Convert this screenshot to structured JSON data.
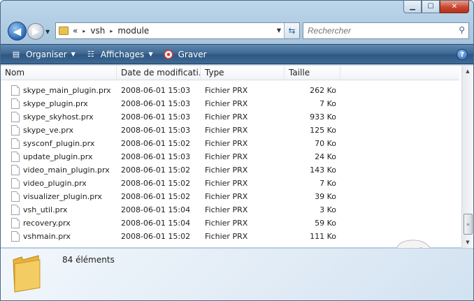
{
  "titlebar": {
    "buttons": {
      "minimize": "▁",
      "maximize": "☐",
      "close": "✕"
    }
  },
  "navigation": {
    "back_icon": "back-arrow-icon",
    "forward_icon": "forward-arrow-icon",
    "history_icon": "chevron-down-icon"
  },
  "address": {
    "overflow": "«",
    "segments": [
      "vsh",
      "module"
    ],
    "separator": "▸",
    "refresh_icon": "refresh-icon"
  },
  "search": {
    "placeholder": "Rechercher",
    "value": ""
  },
  "toolbar": {
    "organize_label": "Organiser",
    "views_label": "Affichages",
    "burn_label": "Graver",
    "help_label": "?"
  },
  "columns": {
    "name": "Nom",
    "date": "Date de modificati...",
    "type": "Type",
    "size": "Taille"
  },
  "files": [
    {
      "name": "skype_main_plugin.prx",
      "date": "2008-06-01 15:03",
      "type": "Fichier PRX",
      "size": "262 Ko"
    },
    {
      "name": "skype_plugin.prx",
      "date": "2008-06-01 15:03",
      "type": "Fichier PRX",
      "size": "7 Ko"
    },
    {
      "name": "skype_skyhost.prx",
      "date": "2008-06-01 15:03",
      "type": "Fichier PRX",
      "size": "933 Ko"
    },
    {
      "name": "skype_ve.prx",
      "date": "2008-06-01 15:03",
      "type": "Fichier PRX",
      "size": "125 Ko"
    },
    {
      "name": "sysconf_plugin.prx",
      "date": "2008-06-01 15:02",
      "type": "Fichier PRX",
      "size": "70 Ko"
    },
    {
      "name": "update_plugin.prx",
      "date": "2008-06-01 15:03",
      "type": "Fichier PRX",
      "size": "24 Ko"
    },
    {
      "name": "video_main_plugin.prx",
      "date": "2008-06-01 15:02",
      "type": "Fichier PRX",
      "size": "143 Ko"
    },
    {
      "name": "video_plugin.prx",
      "date": "2008-06-01 15:02",
      "type": "Fichier PRX",
      "size": "7 Ko"
    },
    {
      "name": "visualizer_plugin.prx",
      "date": "2008-06-01 15:02",
      "type": "Fichier PRX",
      "size": "39 Ko"
    },
    {
      "name": "vsh_util.prx",
      "date": "2008-06-01 15:04",
      "type": "Fichier PRX",
      "size": "3 Ko"
    },
    {
      "name": "recovery.prx",
      "date": "2008-06-01 15:04",
      "type": "Fichier PRX",
      "size": "59 Ko"
    },
    {
      "name": "vshmain.prx",
      "date": "2008-06-01 15:02",
      "type": "Fichier PRX",
      "size": "111 Ko"
    }
  ],
  "highlight_color": "#d6181c",
  "details": {
    "count_text": "84 éléments"
  }
}
